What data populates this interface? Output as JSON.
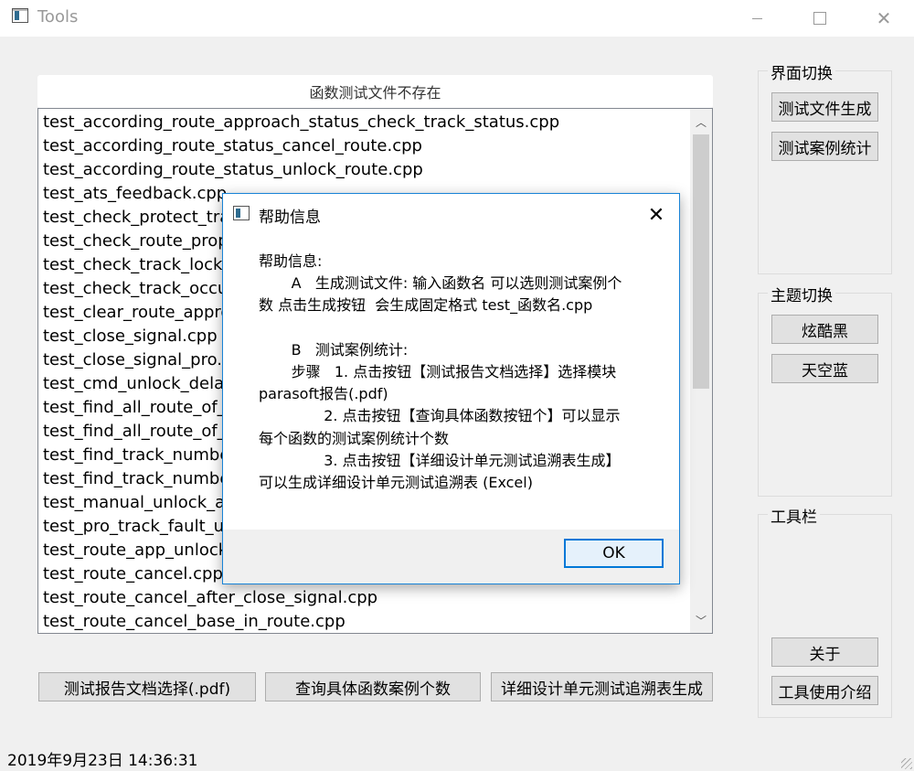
{
  "window": {
    "title": "Tools"
  },
  "main": {
    "header_label": "函数测试文件不存在",
    "files": [
      "test_according_route_approach_status_check_track_status.cpp",
      "test_according_route_status_cancel_route.cpp",
      "test_according_route_status_unlock_route.cpp",
      "test_ats_feedback.cpp",
      "test_check_protect_track",
      "test_check_route_prope",
      "test_check_track_lock_a",
      "test_check_track_occup",
      "test_clear_route_appro",
      "test_close_signal.cpp",
      "test_close_signal_pro.cp",
      "test_cmd_unlock_delay",
      "test_find_all_route_of_r",
      "test_find_all_route_of_p",
      "test_find_track_numbe",
      "test_find_track_numbe",
      "test_manual_unlock_aft",
      "test_pro_track_fault_un",
      "test_route_app_unlock.",
      "test_route_cancel.cpp",
      "test_route_cancel_after_close_signal.cpp",
      "test_route_cancel_base_in_route.cpp"
    ],
    "buttons": {
      "report_select": "测试报告文档选择(.pdf)",
      "query_count": "查询具体函数案例个数",
      "trace_table": "详细设计单元测试追溯表生成"
    },
    "status_time": "2019年9月23日 14:36:31"
  },
  "sidebar": {
    "ui_switch": {
      "title": "界面切换",
      "buttons": [
        "测试文件生成",
        "测试案例统计"
      ]
    },
    "theme_switch": {
      "title": "主题切换",
      "buttons": [
        "炫酷黑",
        "天空蓝"
      ]
    },
    "toolbar": {
      "title": "工具栏",
      "buttons": [
        "关于",
        "工具使用介绍"
      ]
    }
  },
  "dialog": {
    "title": "帮助信息",
    "lines": [
      "帮助信息:",
      "       A   生成测试文件: 输入函数名 可以选则测试案例个",
      "数 点击生成按钮  会生成固定格式 test_函数名.cpp",
      "",
      "       B   测试案例统计:",
      "       步骤   1. 点击按钮【测试报告文档选择】选择模块",
      "parasoft报告(.pdf)",
      "              2. 点击按钮【查询具体函数按钮个】可以显示",
      "每个函数的测试案例统计个数",
      "              3. 点击按钮【详细设计单元测试追溯表生成】",
      "可以生成详细设计单元测试追溯表 (Excel)"
    ],
    "ok_label": "OK"
  }
}
